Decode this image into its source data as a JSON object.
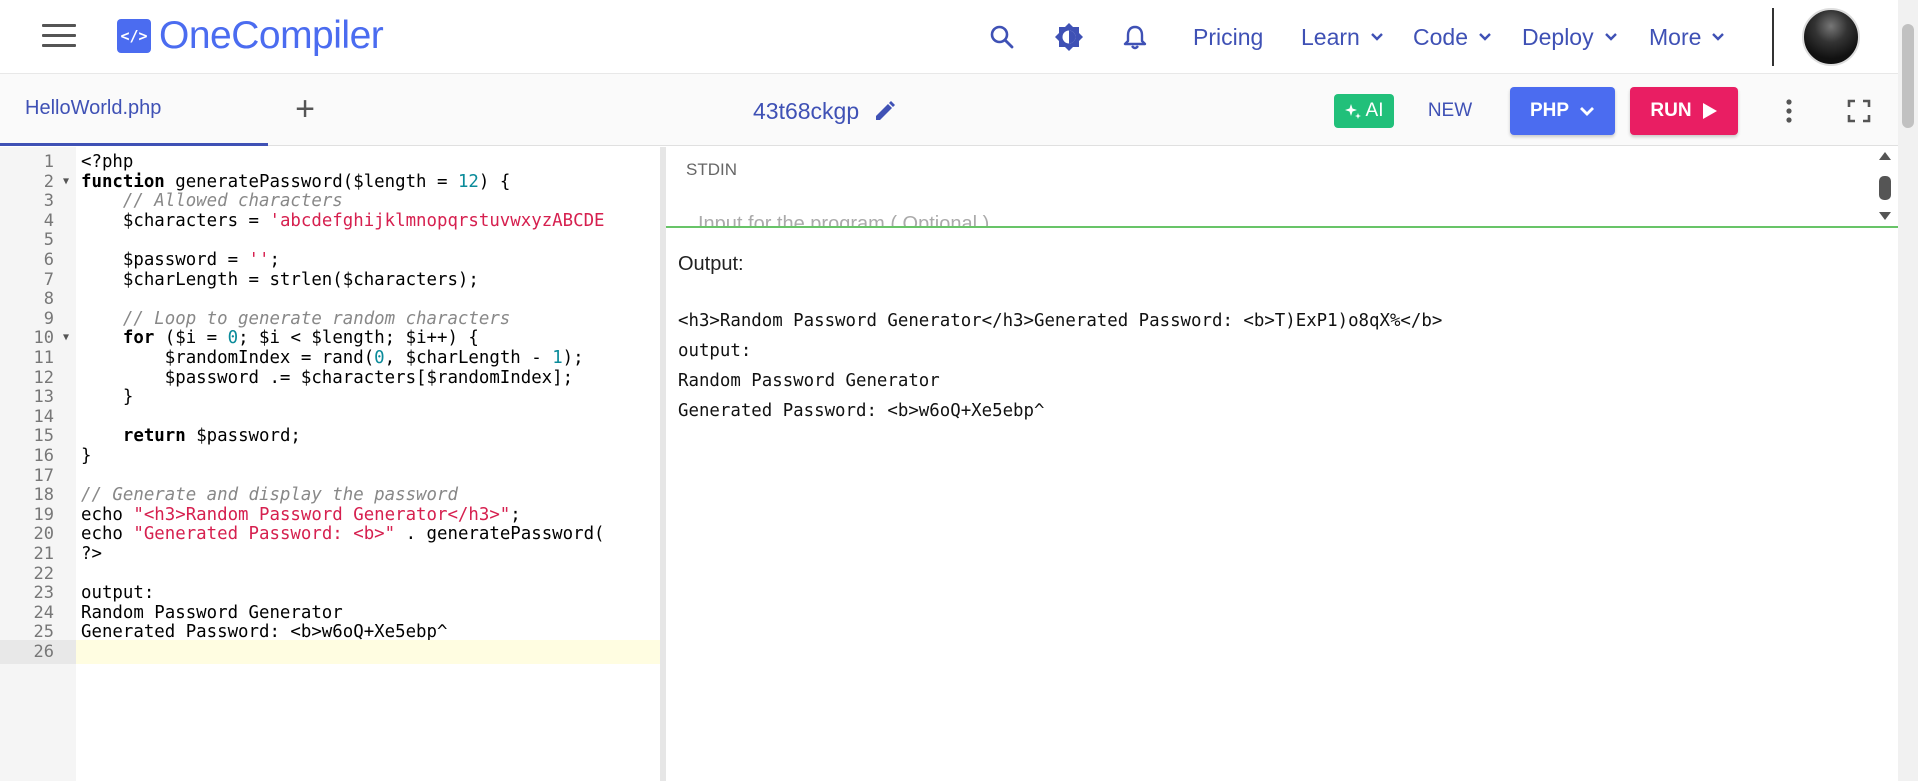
{
  "nav": {
    "brand_mark": "</>",
    "brand": "OneCompiler",
    "links": [
      {
        "label": "Pricing",
        "dropdown": false
      },
      {
        "label": "Learn",
        "dropdown": true
      },
      {
        "label": "Code",
        "dropdown": true
      },
      {
        "label": "Deploy",
        "dropdown": true
      },
      {
        "label": "More",
        "dropdown": true
      }
    ],
    "icons": [
      "search-icon",
      "theme-toggle-icon",
      "bell-icon"
    ]
  },
  "toolbar": {
    "file_tab": "HelloWorld.php",
    "add_tab": "+",
    "code_title": "43t68ckgp",
    "ai_label": "AI",
    "new_label": "NEW",
    "language": "PHP",
    "run_label": "RUN"
  },
  "editor": {
    "lines": [
      "<?php",
      "function generatePassword($length = 12) {",
      "    // Allowed characters",
      "    $characters = 'abcdefghijklmnopqrstuvwxyzABCDE",
      "",
      "    $password = '';",
      "    $charLength = strlen($characters);",
      "",
      "    // Loop to generate random characters",
      "    for ($i = 0; $i < $length; $i++) {",
      "        $randomIndex = rand(0, $charLength - 1);",
      "        $password .= $characters[$randomIndex];",
      "    }",
      "",
      "    return $password;",
      "}",
      "",
      "// Generate and display the password",
      "echo \"<h3>Random Password Generator</h3>\";",
      "echo \"Generated Password: <b>\" . generatePassword(",
      "?>",
      "",
      "output:",
      "Random Password Generator",
      "Generated Password: <b>w6oQ+Xe5ebp^",
      ""
    ],
    "fold_lines": [
      2,
      10
    ],
    "active_line": 26
  },
  "stdin": {
    "label": "STDIN",
    "placeholder": "Input for the program ( Optional )"
  },
  "output": {
    "label": "Output:",
    "text": "<h3>Random Password Generator</h3>Generated Password: <b>T)ExP1)o8qX%</b>\noutput:\nRandom Password Generator\nGenerated Password: <b>w6oQ+Xe5ebp^"
  },
  "colors": {
    "accent": "#3f51b5",
    "brand_blue": "#4b6cf0",
    "run_pink": "#e91e63",
    "ai_green": "#21c07a",
    "string_red": "#d6204f",
    "number_teal": "#0a8b9a",
    "comment_gray": "#888888"
  }
}
